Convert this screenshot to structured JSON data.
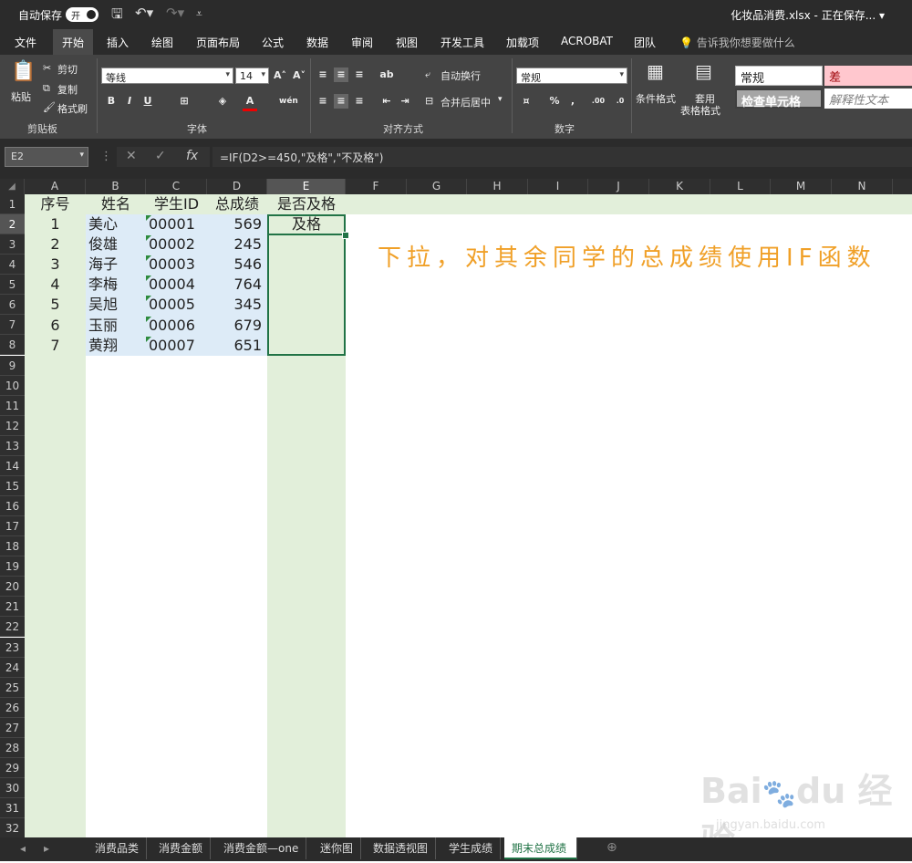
{
  "titlebar": {
    "autosave_label": "自动保存",
    "autosave_state": "开",
    "document_title": "化妆品消费.xlsx - 正在保存... ▾"
  },
  "tabs": [
    "文件",
    "开始",
    "插入",
    "绘图",
    "页面布局",
    "公式",
    "数据",
    "审阅",
    "视图",
    "开发工具",
    "加载项",
    "ACROBAT",
    "团队"
  ],
  "active_tab": "开始",
  "tell_me": "告诉我你想要做什么",
  "ribbon": {
    "clipboard": {
      "paste": "粘贴",
      "cut": "剪切",
      "copy": "复制",
      "format_painter": "格式刷",
      "label": "剪贴板"
    },
    "font": {
      "name": "等线",
      "size": "14",
      "label": "字体"
    },
    "alignment": {
      "wrap": "自动换行",
      "merge": "合并后居中",
      "label": "对齐方式"
    },
    "number": {
      "format": "常规",
      "label": "数字"
    },
    "styles": {
      "conditional": "条件格式",
      "table": "套用",
      "table2": "表格格式",
      "normal": "常规",
      "bad": "差",
      "check": "检查单元格",
      "explain": "解释性文本"
    }
  },
  "formula_bar": {
    "name_box": "E2",
    "formula": "=IF(D2>=450,\"及格\",\"不及格\")"
  },
  "columns": [
    "A",
    "B",
    "C",
    "D",
    "E",
    "F",
    "G",
    "H",
    "I",
    "J",
    "K",
    "L",
    "M",
    "N"
  ],
  "selected_column": "E",
  "rows": [
    "1",
    "2",
    "3",
    "4",
    "5",
    "6",
    "7",
    "8",
    "9",
    "10",
    "11",
    "12",
    "13",
    "14",
    "15",
    "16",
    "17",
    "18",
    "19",
    "20",
    "21",
    "22",
    "23",
    "24",
    "25",
    "26",
    "27",
    "28",
    "29",
    "30",
    "31",
    "32"
  ],
  "sheet": {
    "headers": [
      "序号",
      "姓名",
      "学生ID",
      "总成绩",
      "是否及格"
    ],
    "records": [
      {
        "no": "1",
        "name": "美心",
        "id": "00001",
        "score": "569",
        "pass": "及格"
      },
      {
        "no": "2",
        "name": "俊雄",
        "id": "00002",
        "score": "245",
        "pass": ""
      },
      {
        "no": "3",
        "name": "海子",
        "id": "00003",
        "score": "546",
        "pass": ""
      },
      {
        "no": "4",
        "name": "李梅",
        "id": "00004",
        "score": "764",
        "pass": ""
      },
      {
        "no": "5",
        "name": "吴旭",
        "id": "00005",
        "score": "345",
        "pass": ""
      },
      {
        "no": "6",
        "name": "玉丽",
        "id": "00006",
        "score": "679",
        "pass": ""
      },
      {
        "no": "7",
        "name": "黄翔",
        "id": "00007",
        "score": "651",
        "pass": ""
      }
    ]
  },
  "annotation": "下拉，对其余同学的总成绩使用IF函数",
  "watermark": {
    "brand": "Bai du 经验",
    "url": "jingyan.baidu.com"
  },
  "sheet_tabs": [
    "消费品类",
    "消费金额",
    "消费金额—one",
    "迷你图",
    "数据透视图",
    "学生成绩",
    "期末总成绩"
  ],
  "active_sheet": "期末总成绩",
  "colors": {
    "accent": "#217346",
    "annotation": "#f0a028",
    "col_a_fill": "#e2efda",
    "data_fill": "#ddebf7"
  }
}
